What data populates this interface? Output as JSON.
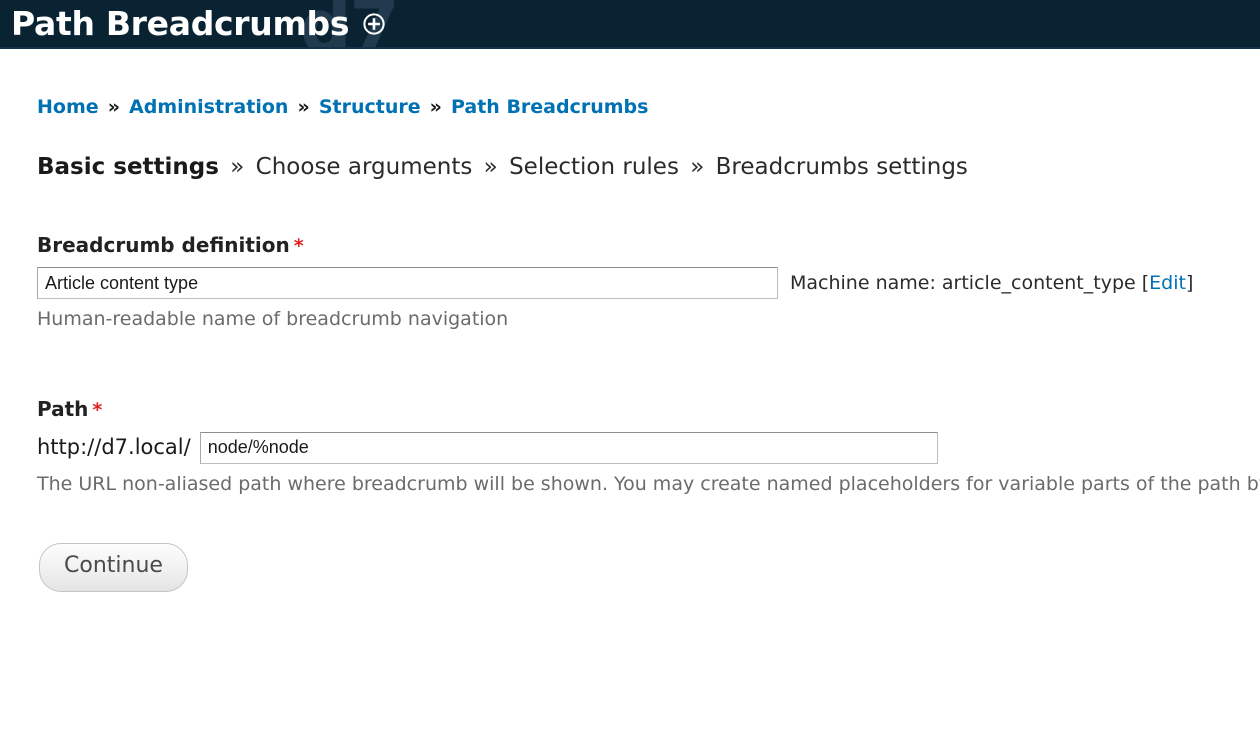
{
  "header": {
    "title": "Path Breadcrumbs",
    "watermark": "d7",
    "add_icon": "plus-circle-icon"
  },
  "breadcrumb": {
    "separator": "»",
    "items": [
      {
        "label": "Home",
        "link": true
      },
      {
        "label": "Administration",
        "link": true
      },
      {
        "label": "Structure",
        "link": true
      },
      {
        "label": "Path Breadcrumbs",
        "link": true
      }
    ]
  },
  "steps": {
    "separator": "»",
    "items": [
      {
        "label": "Basic settings",
        "active": true
      },
      {
        "label": "Choose arguments",
        "active": false
      },
      {
        "label": "Selection rules",
        "active": false
      },
      {
        "label": "Breadcrumbs settings",
        "active": false
      }
    ]
  },
  "form": {
    "definition": {
      "label": "Breadcrumb definition",
      "required_mark": "*",
      "value": "Article content type",
      "placeholder": "",
      "machine_name_prefix": "Machine name: ",
      "machine_name_value": "article_content_type",
      "machine_name_bracket_open": " [",
      "machine_name_edit": "Edit",
      "machine_name_bracket_close": "]",
      "description": "Human-readable name of breadcrumb navigation"
    },
    "path": {
      "label": "Path",
      "required_mark": "*",
      "url_prefix": "http://d7.local/",
      "value": "node/%node",
      "placeholder": "",
      "description": "The URL non-aliased path where breadcrumb will be shown. You may create named placeholders for variable parts of the path by using the format %name for required elements and !name for optional elements. For example: \"node/%node/foo\" or \"taxonomy/term/%term\". These named placeholders can be turned into contextual filters below."
    },
    "submit_label": "Continue"
  }
}
